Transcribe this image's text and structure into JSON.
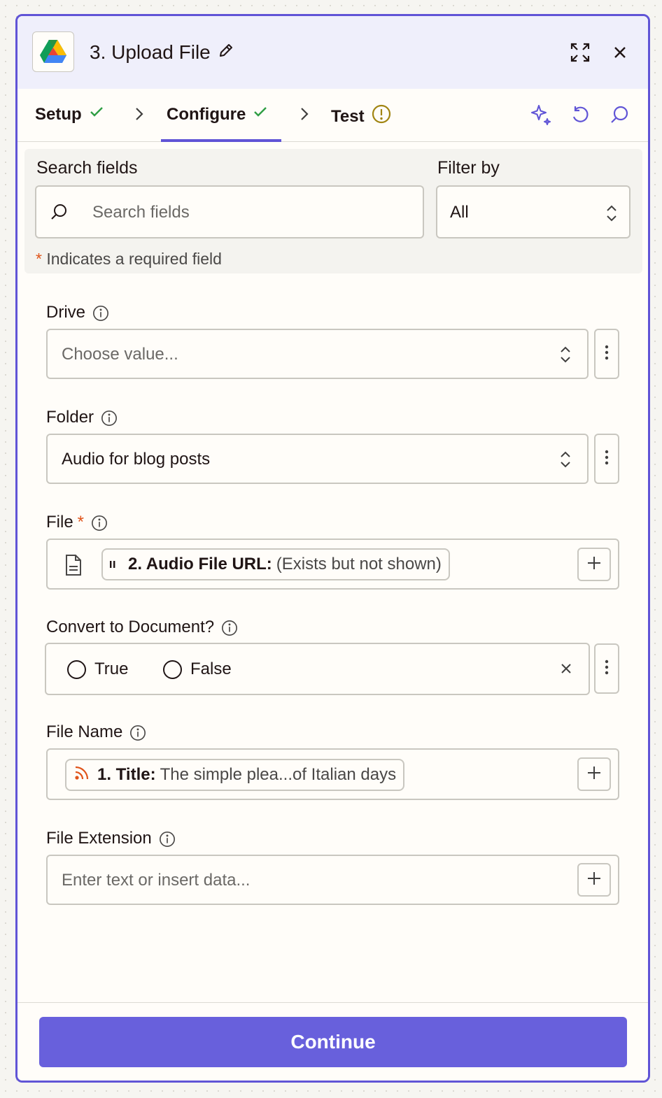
{
  "header": {
    "app_icon": "google-drive-logo",
    "title": "3. Upload File",
    "edit_icon": "pencil-icon",
    "expand_icon": "expand-icon",
    "close_icon": "close-icon"
  },
  "tabs": [
    {
      "label": "Setup",
      "status": "check"
    },
    {
      "label": "Configure",
      "status": "check",
      "active": true
    },
    {
      "label": "Test",
      "status": "warning"
    }
  ],
  "toolbar": {
    "icons": [
      "sparkle-icon",
      "undo-icon",
      "search-icon"
    ]
  },
  "search": {
    "label": "Search fields",
    "placeholder": "Search fields",
    "filter_label": "Filter by",
    "filter_value": "All",
    "required_star": "*",
    "required_note": "Indicates a required field"
  },
  "fields": {
    "drive": {
      "label": "Drive",
      "placeholder": "Choose value..."
    },
    "folder": {
      "label": "Folder",
      "value": "Audio for blog posts"
    },
    "file": {
      "label": "File",
      "required_star": "*",
      "token_key": "2. Audio File URL:",
      "token_value": "(Exists but not shown)"
    },
    "convert": {
      "label": "Convert to Document?",
      "options": [
        "True",
        "False"
      ]
    },
    "file_name": {
      "label": "File Name",
      "token_key": "1. Title:",
      "token_value": "The simple plea...of Italian days"
    },
    "file_extension": {
      "label": "File Extension",
      "placeholder": "Enter text or insert data..."
    }
  },
  "footer": {
    "continue_label": "Continue"
  },
  "colors": {
    "accent": "#6054d6",
    "button": "#6860dc",
    "check": "#2f9e44",
    "warning": "#a18512",
    "required": "#e0541a"
  }
}
